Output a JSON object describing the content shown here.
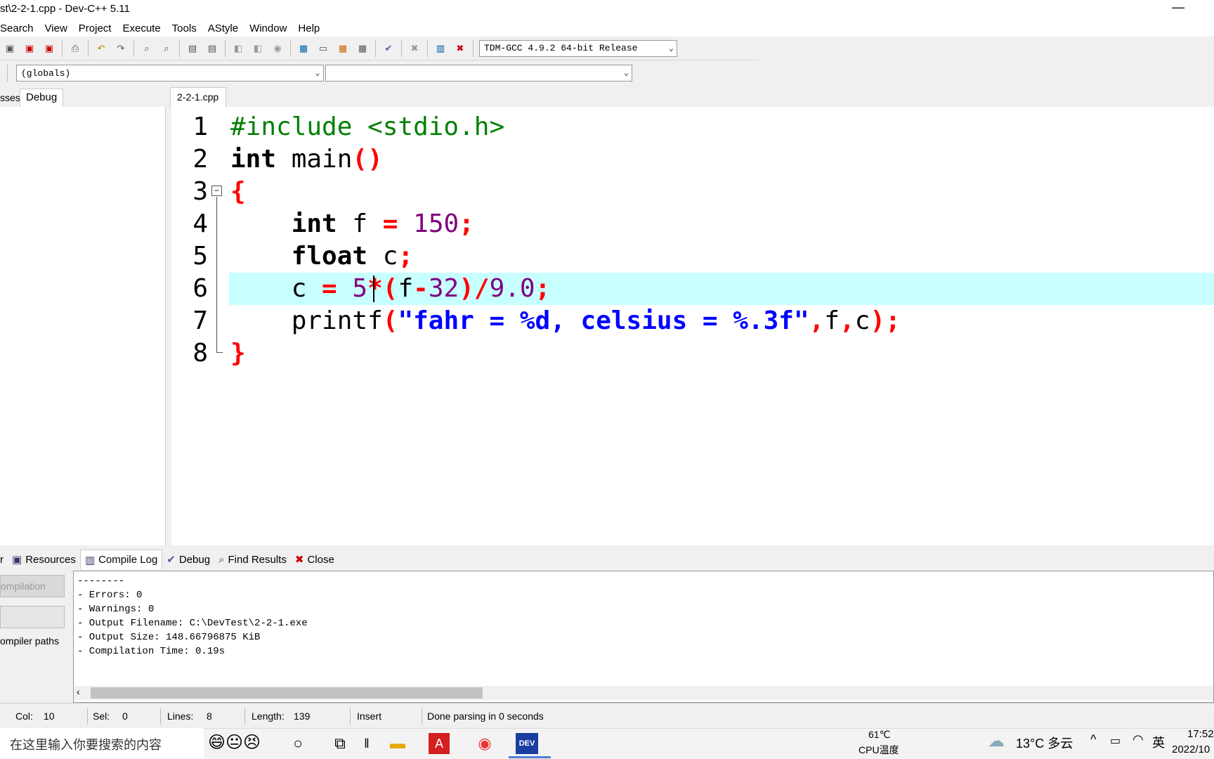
{
  "window": {
    "title": "st\\2-2-1.cpp - Dev-C++ 5.11",
    "minimize_glyph": "—"
  },
  "menu": [
    "Search",
    "View",
    "Project",
    "Execute",
    "Tools",
    "AStyle",
    "Window",
    "Help"
  ],
  "toolbar": {
    "compiler": "TDM-GCC 4.9.2 64-bit Release"
  },
  "toolbar2": {
    "scope": "(globals)",
    "member": ""
  },
  "left_tabs": [
    "sses",
    "Debug"
  ],
  "editor": {
    "tab": "2-2-1.cpp",
    "line_numbers": [
      "1",
      "2",
      "3",
      "4",
      "5",
      "6",
      "7",
      "8"
    ],
    "lines": [
      [
        {
          "t": "#include <stdio.h>",
          "c": "pp"
        }
      ],
      [
        {
          "t": "int",
          "c": "kw"
        },
        {
          "t": " main",
          "c": ""
        },
        {
          "t": "()",
          "c": "sym"
        }
      ],
      [
        {
          "t": "{",
          "c": "sym"
        }
      ],
      [
        {
          "t": "    ",
          "c": ""
        },
        {
          "t": "int",
          "c": "kw"
        },
        {
          "t": " f ",
          "c": ""
        },
        {
          "t": "=",
          "c": "sym"
        },
        {
          "t": " ",
          "c": ""
        },
        {
          "t": "150",
          "c": "num"
        },
        {
          "t": ";",
          "c": "sym"
        }
      ],
      [
        {
          "t": "    ",
          "c": ""
        },
        {
          "t": "float",
          "c": "kw"
        },
        {
          "t": " c",
          "c": ""
        },
        {
          "t": ";",
          "c": "sym"
        }
      ],
      [
        {
          "t": "    c ",
          "c": ""
        },
        {
          "t": "=",
          "c": "sym"
        },
        {
          "t": " ",
          "c": ""
        },
        {
          "t": "5",
          "c": "num"
        },
        {
          "t": "*(",
          "c": "sym"
        },
        {
          "t": "f",
          "c": ""
        },
        {
          "t": "-",
          "c": "sym"
        },
        {
          "t": "32",
          "c": "num"
        },
        {
          "t": ")/",
          "c": "sym"
        },
        {
          "t": "9.0",
          "c": "num"
        },
        {
          "t": ";",
          "c": "sym"
        }
      ],
      [
        {
          "t": "    printf",
          "c": ""
        },
        {
          "t": "(",
          "c": "sym"
        },
        {
          "t": "\"fahr = %d, celsius = %.3f\"",
          "c": "str"
        },
        {
          "t": ",",
          "c": "sym"
        },
        {
          "t": "f",
          "c": ""
        },
        {
          "t": ",",
          "c": "sym"
        },
        {
          "t": "c",
          "c": ""
        },
        {
          "t": ");",
          "c": "sym"
        }
      ],
      [
        {
          "t": "}",
          "c": "sym"
        }
      ]
    ]
  },
  "bottom_tabs": [
    {
      "label": "r",
      "icon": ""
    },
    {
      "label": "Resources",
      "icon": "resources-icon"
    },
    {
      "label": "Compile Log",
      "icon": "chart-icon"
    },
    {
      "label": "Debug",
      "icon": "check-icon"
    },
    {
      "label": "Find Results",
      "icon": "find-icon"
    },
    {
      "label": "Close",
      "icon": "close-icon"
    }
  ],
  "bottom_left": {
    "abort": "ompilation",
    "blank": "",
    "paths": "ompiler paths"
  },
  "log": [
    "--------",
    "- Errors: 0",
    "- Warnings: 0",
    "- Output Filename: C:\\DevTest\\2-2-1.exe",
    "- Output Size: 148.66796875 KiB",
    "- Compilation Time: 0.19s"
  ],
  "status": {
    "col_label": "Col:",
    "col": "10",
    "sel_label": "Sel:",
    "sel": "0",
    "lines_label": "Lines:",
    "lines": "8",
    "length_label": "Length:",
    "length": "139",
    "mode": "Insert",
    "message": "Done parsing in 0 seconds"
  },
  "taskbar": {
    "search_placeholder": "在这里输入你要搜索的内容",
    "emoji": "😄😐😣",
    "cpu_temp": "61℃",
    "cpu_label": "CPU温度",
    "weather": "13°C 多云",
    "ime": "英",
    "time": "17:52",
    "date": "2022/10"
  },
  "colors": {
    "highlight_line": "#c8ffff",
    "symbol": "#ff0000",
    "number": "#800080",
    "string": "#0000ff",
    "preprocessor": "#008000"
  }
}
